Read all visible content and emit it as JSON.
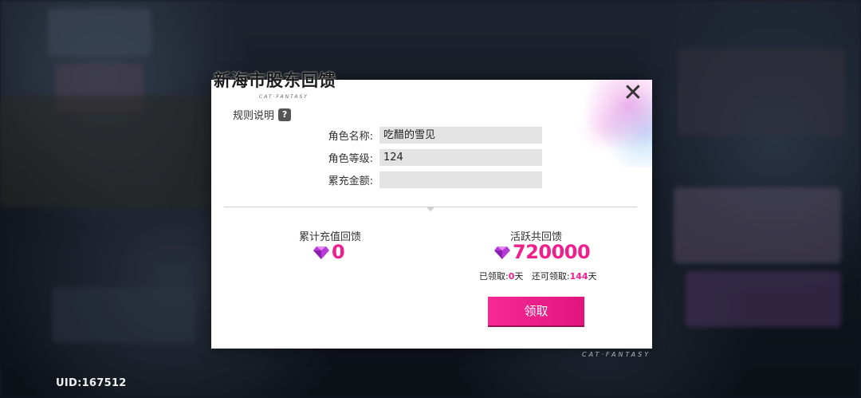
{
  "background": {
    "uid_text": "UID:167512",
    "brand_text": "CAT·FANTASY"
  },
  "modal": {
    "title": "新海市股东回馈",
    "subtitle": "CAT·FANTASY",
    "rules_label": "规则说明",
    "help_icon_glyph": "?",
    "close_glyph": "✕",
    "fields": [
      {
        "label": "角色名称:",
        "value": "吃醋的雪见"
      },
      {
        "label": "角色等级:",
        "value": "124"
      },
      {
        "label": "累充金额:",
        "value": ""
      }
    ],
    "recharge": {
      "title": "累计充值回馈",
      "value": "0",
      "icon": "gem-icon"
    },
    "active": {
      "title": "活跃共回馈",
      "value": "720000",
      "icon": "gem-icon"
    },
    "claimed_label": "已领取:",
    "claimed_days": "0",
    "remaining_label": "还可领取:",
    "remaining_days": "144",
    "day_unit": "天",
    "claim_button": "领取",
    "accent_color": "#ef1f8c"
  }
}
